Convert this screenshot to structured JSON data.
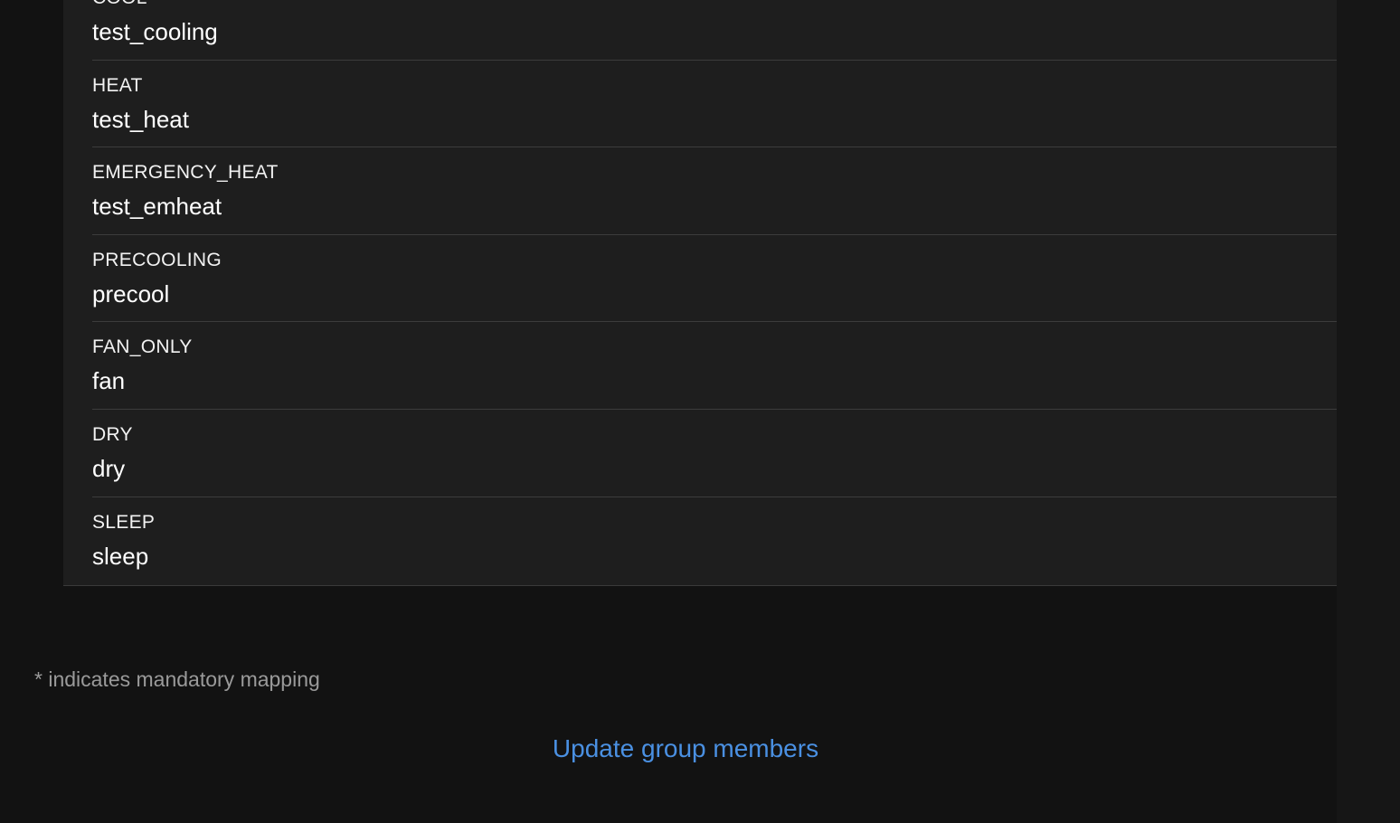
{
  "mappings": [
    {
      "key": "COOL",
      "value": "test_cooling"
    },
    {
      "key": "HEAT",
      "value": "test_heat"
    },
    {
      "key": "EMERGENCY_HEAT",
      "value": "test_emheat"
    },
    {
      "key": "PRECOOLING",
      "value": "precool"
    },
    {
      "key": "FAN_ONLY",
      "value": "fan"
    },
    {
      "key": "DRY",
      "value": "dry"
    },
    {
      "key": "SLEEP",
      "value": "sleep"
    }
  ],
  "footnote": "* indicates mandatory mapping",
  "update_link": "Update group members",
  "colors": {
    "background": "#121212",
    "card": "#1e1e1e",
    "divider": "#3c3c3c",
    "link": "#4a90e2",
    "muted_text": "#9a9a9a"
  }
}
